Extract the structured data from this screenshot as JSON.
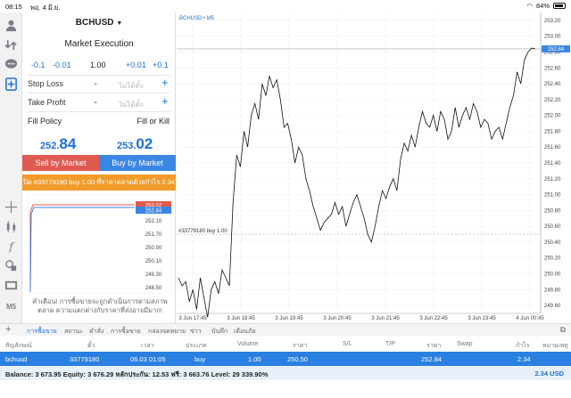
{
  "status_bar": {
    "time": "08:15",
    "date": "พฤ. 4 มิ.ย.",
    "battery": "84%"
  },
  "order": {
    "symbol": "BCHUSD",
    "execution": "Market Execution",
    "volume_steps": [
      "-0.1",
      "-0.01",
      "+0.01",
      "+0.1"
    ],
    "volume": "1.00",
    "stop_loss_label": "Stop Loss",
    "take_profit_label": "Take Profit",
    "placeholder": "ไม่ได้ตั้ง",
    "minus": "-",
    "plus": "+",
    "fill_policy_label": "Fill Policy",
    "fill_policy_value": "Fill or Kill",
    "sell_price_small": "252.",
    "sell_price_big": "84",
    "buy_price_small": "253.",
    "buy_price_big": "02",
    "sell_button": "Sell by Market",
    "buy_button": "Buy by Market",
    "close_button": "ปิด #33779180 buy 1.00 ที่ราคาตลาดด้วยกำไร 2.34",
    "warning": "คำเตือน! การซื้อขายจะถูกดำเนินการตามสภาพตลาด ความแตกต่างกับราคาที่ส่งอาจมีมาก!",
    "mini_prices": [
      "253.02",
      "252.84",
      "252.10",
      "251.70",
      "250.90",
      "250.10",
      "249.30",
      "248.50"
    ]
  },
  "chart_data": {
    "type": "line",
    "title": "BCHUSD • M5",
    "x_labels": [
      "3 Jun 17:45",
      "3 Jun 18:45",
      "3 Jun 19:45",
      "3 Jun 20:45",
      "3 Jun 21:45",
      "3 Jun 22:45",
      "3 Jun 23:45",
      "4 Jun 00:45"
    ],
    "y_ticks": [
      "253.20",
      "253.00",
      "252.80",
      "252.60",
      "252.40",
      "252.20",
      "252.00",
      "251.80",
      "251.60",
      "251.40",
      "251.20",
      "251.00",
      "250.80",
      "250.60",
      "250.40",
      "250.20",
      "250.00",
      "249.80",
      "249.60"
    ],
    "ylim": [
      249.5,
      253.3
    ],
    "current_price": "252.84",
    "position_label": "#33779180 buy 1.00",
    "position_price": 250.5,
    "values": [
      249.95,
      249.85,
      249.9,
      249.65,
      249.8,
      249.55,
      249.95,
      249.7,
      249.45,
      249.8,
      249.9,
      249.75,
      250.05,
      249.95,
      249.85,
      250.9,
      251.5,
      251.35,
      251.8,
      251.6,
      252.0,
      252.15,
      251.95,
      252.4,
      252.25,
      252.5,
      252.35,
      252.45,
      252.2,
      251.85,
      251.9,
      251.7,
      251.4,
      251.6,
      251.5,
      251.2,
      251.05,
      250.85,
      250.7,
      250.55,
      250.65,
      250.7,
      250.75,
      250.9,
      250.75,
      250.85,
      250.6,
      250.75,
      250.9,
      251.0,
      250.85,
      250.7,
      250.5,
      250.4,
      250.6,
      250.85,
      251.05,
      250.95,
      251.1,
      251.2,
      251.05,
      251.45,
      251.65,
      251.55,
      251.75,
      251.6,
      251.85,
      252.05,
      251.9,
      251.85,
      252.0,
      251.8,
      252.05,
      251.95,
      251.7,
      251.8,
      252.1,
      251.85,
      252.0,
      252.1,
      251.95,
      252.15,
      252.05,
      251.85,
      251.95,
      251.9,
      251.7,
      251.8,
      251.85,
      251.7,
      251.9,
      252.1,
      252.25,
      252.55,
      252.4,
      252.7,
      252.8,
      252.85,
      252.84
    ]
  },
  "tabs": [
    "การซื้อขาย",
    "สถานะ",
    "คำสั่ง",
    "การซื้อขาย",
    "กล่องจดหมาย",
    "ข่าว",
    "บันทึก",
    "เตือนภัย"
  ],
  "columns": [
    "สัญลักษณ์",
    "ตั๋ว",
    "เวลา",
    "ประเภท",
    "Volume",
    "ราคา",
    "S/L",
    "T/P",
    "ราคา",
    "Swap",
    "กำไร",
    "หมายเหตุ"
  ],
  "position": {
    "symbol": "bchusd",
    "ticket": "33779180",
    "time": "06.03 01:05",
    "type": "buy",
    "volume": "1.00",
    "price_open": "250.50",
    "price_current": "252.84",
    "profit": "2.34"
  },
  "balance": {
    "text": "Balance: 3 673.95 Equity: 3 676.29 หลักประกัน: 12.53 ฟรี: 3 663.76 Level: 29 339.90%",
    "total": "2.34",
    "currency": "USD"
  }
}
